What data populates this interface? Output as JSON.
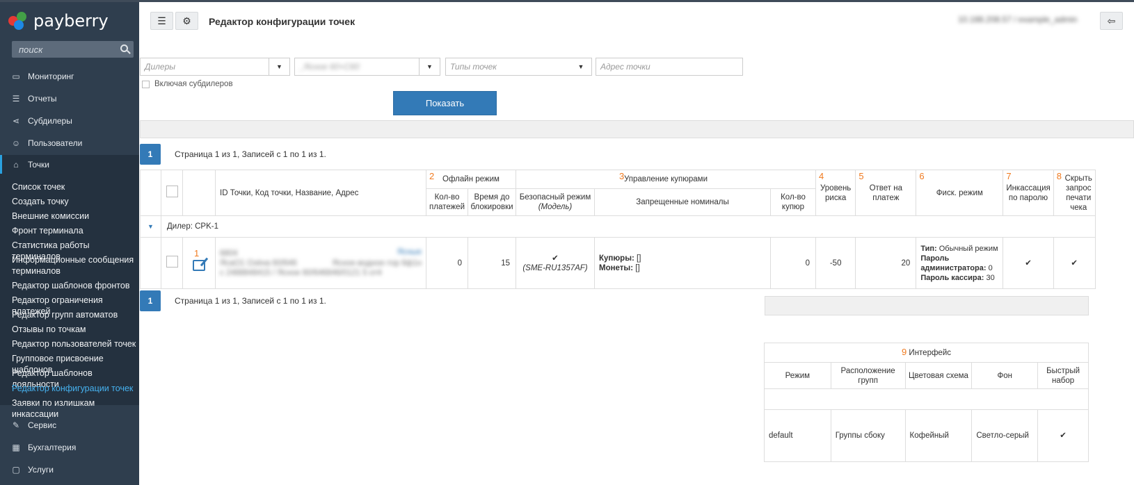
{
  "sidebar": {
    "logo_text": "payberry",
    "search_placeholder": "поиск",
    "nav": [
      {
        "label": "Мониторинг",
        "icon": "monitor-icon"
      },
      {
        "label": "Отчеты",
        "icon": "list-icon"
      },
      {
        "label": "Субдилеры",
        "icon": "share-icon"
      },
      {
        "label": "Пользователи",
        "icon": "users-icon"
      },
      {
        "label": "Точки",
        "icon": "tag-icon"
      }
    ],
    "sub_items": [
      "Список точек",
      "Создать точку",
      "Внешние комиссии",
      "Фронт терминала",
      "Статистика работы терминалов",
      "Информационные сообщения терминалов",
      "Редактор шаблонов фронтов",
      "Редактор ограничения платежей",
      "Редактор групп автоматов",
      "Отзывы по точкам",
      "Редактор пользователей точек",
      "Групповое присвоение шаблонов",
      "Редактор шаблонов лояльности",
      "Редактор конфигурации точек",
      "Заявки по излишкам инкассации"
    ],
    "nav_bottom": [
      {
        "label": "Сервис",
        "icon": "wrench-icon"
      },
      {
        "label": "Бухгалтерия",
        "icon": "calculator-icon"
      },
      {
        "label": "Услуги",
        "icon": "folder-icon"
      }
    ]
  },
  "header": {
    "title": "Редактор конфигурации точек",
    "user": "10.188.208.57 / example_admin"
  },
  "filters": {
    "dealers_placeholder": "Дилеры",
    "points_value": "_Ясное 60+С60",
    "types_placeholder": "Типы точек",
    "address_placeholder": "Адрес точки",
    "include_subdealers": "Включая субдилеров",
    "show_button": "Показать"
  },
  "pager": {
    "page": "1",
    "text": "Страница 1 из 1, Записей с 1 по 1 из 1."
  },
  "table": {
    "col_id": "ID Точки,  Код точки,  Название,  Адрес",
    "n2": "2",
    "offline": "Офлайн режим",
    "n3": "3",
    "bills": "Управление купюрами",
    "n4": "4",
    "risk": "Уровень риска",
    "n5": "5",
    "answer": "Ответ на платеж",
    "n6": "6",
    "fisc": "Фиск. режим",
    "n7": "7",
    "collection": "Инкассация по паролю",
    "n8": "8",
    "hide": "Скрыть запрос печати чека",
    "count_pay": "Кол-во платежей",
    "block_time": "Время до блокировки",
    "safe_mode": "Безопасный режим",
    "model": "(Модель)",
    "forbidden": "Запрещенные номиналы",
    "count_bills": "Кол-во купюр",
    "dealer": "Дилер: CPK-1",
    "row": {
      "n1": "1",
      "id_blur": "6804",
      "code_blur": "ЯсаО1 Озёна 60/646",
      "addr_blur": "с 2488848415 / Ясное 60/646846/0121 5 от4",
      "meta_blur": "Ясные",
      "meta2_blur": "Ясное-водное-тор 6ф1н",
      "count_pay": "0",
      "block_time": "15",
      "check": "✔",
      "model": "(SME-RU1357AF)",
      "bills_label": "Купюры:",
      "bills_val": " []",
      "coins_label": "Монеты:",
      "coins_val": " []",
      "count_bills": "0",
      "risk": "-50",
      "answer": "20",
      "fisc_type_label": "Тип:",
      "fisc_type_val": " Обычный режим",
      "fisc_admin_label": "Пароль администратора:",
      "fisc_admin_val": " 0",
      "fisc_cashier_label": "Пароль кассира:",
      "fisc_cashier_val": " 30",
      "collection": "✔",
      "hide": "✔"
    }
  },
  "interface": {
    "n9": "9",
    "title": "Интерфейс",
    "headers": [
      "Режим",
      "Расположение групп",
      "Цветовая схема",
      "Фон",
      "Быстрый набор"
    ],
    "row": [
      "default",
      "Группы сбоку",
      "Кофейный",
      "Светло-серый",
      "✔"
    ]
  }
}
